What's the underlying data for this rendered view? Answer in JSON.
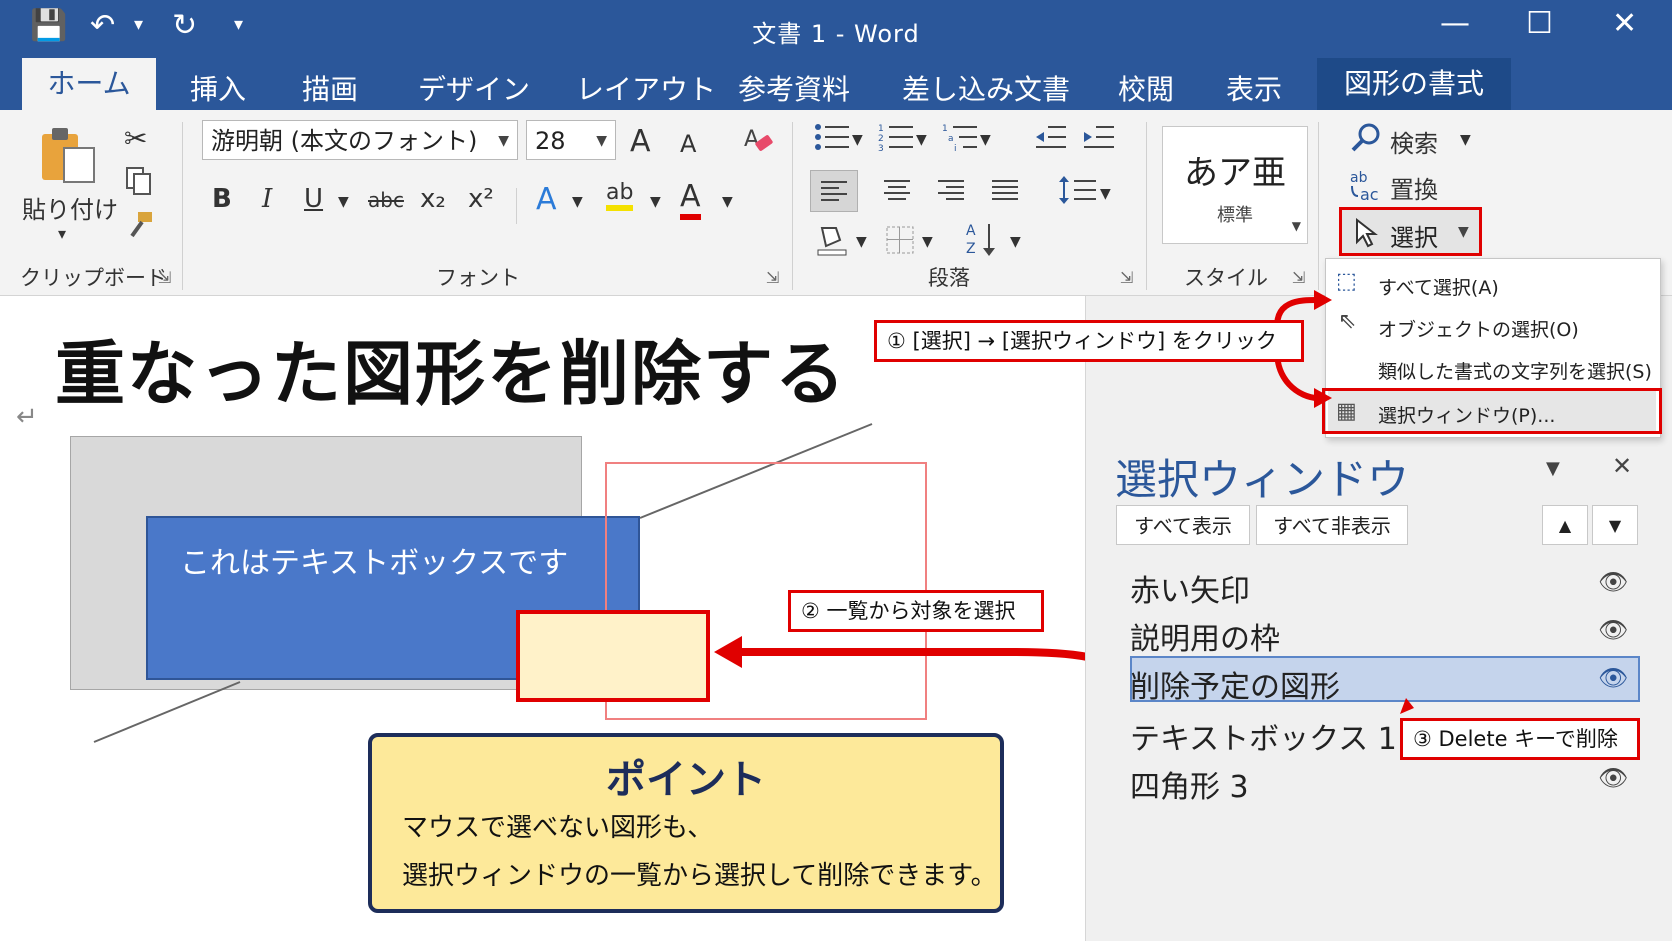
{
  "title_bar": {
    "doc_title": "文書 1  -  Word",
    "save_icon": "💾",
    "undo_icon": "↶",
    "dropdown_glyph": "▾",
    "redo_icon": "↻",
    "customize_icon": "▾",
    "minimize": "—",
    "maximize": "☐",
    "close": "✕"
  },
  "tabs": [
    "ホーム",
    "挿入",
    "描画",
    "デザイン",
    "レイアウト",
    "参考資料",
    "差し込み文書",
    "校閲",
    "表示",
    "図形の書式"
  ],
  "ribbon": {
    "clipboard": {
      "paste": "貼り付け",
      "label": "クリップボード",
      "paste_arrow": "▾"
    },
    "font": {
      "font_name": "游明朝 (本文のフォント)",
      "font_size": "28",
      "grow": "A",
      "shrink": "A",
      "bold": "B",
      "italic": "I",
      "underline": "U",
      "strike": "abc",
      "subscript": "x₂",
      "superscript": "x²",
      "effects": "A",
      "highlight": "ab",
      "color": "A",
      "label": "フォント"
    },
    "paragraph": {
      "label": "段落"
    },
    "styles": {
      "sample": "あア亜",
      "name": "標準",
      "label": "スタイル"
    },
    "editing": {
      "find": "検索",
      "replace": "置換",
      "select": "選択",
      "replace_icon": "ab→ac"
    }
  },
  "select_menu": {
    "items": [
      "すべて選択(A)",
      "オブジェクトの選択(O)",
      "類似した書式の文字列を選択(S)",
      "選択ウィンドウ(P)..."
    ]
  },
  "document": {
    "heading": "重なった図形を削除する",
    "textbox_text": "これはテキストボックスです",
    "return_mark": "↵"
  },
  "selection_pane": {
    "title": "選択ウィンドウ",
    "show_all": "すべて表示",
    "hide_all": "すべて非表示",
    "items": [
      {
        "name": "赤い矢印",
        "selected": false
      },
      {
        "name": "説明用の枠",
        "selected": false
      },
      {
        "name": "削除予定の図形",
        "selected": true
      },
      {
        "name": "テキストボックス 1",
        "selected": false
      },
      {
        "name": "四角形 3",
        "selected": false
      }
    ]
  },
  "callouts": {
    "step1": "① [選択] → [選択ウィンドウ] をクリック",
    "step2": "② 一覧から対象を選択",
    "step3": "③ Delete キーで削除"
  },
  "point": {
    "title": "ポイント",
    "line1": "マウスで選べない図形も、",
    "line2": "選択ウィンドウの一覧から選択して削除できます。"
  },
  "colors": {
    "word_blue": "#2b579a",
    "callout_red": "#e00000",
    "textbox_blue": "#4a78c9",
    "point_yellow": "#fde99a"
  }
}
